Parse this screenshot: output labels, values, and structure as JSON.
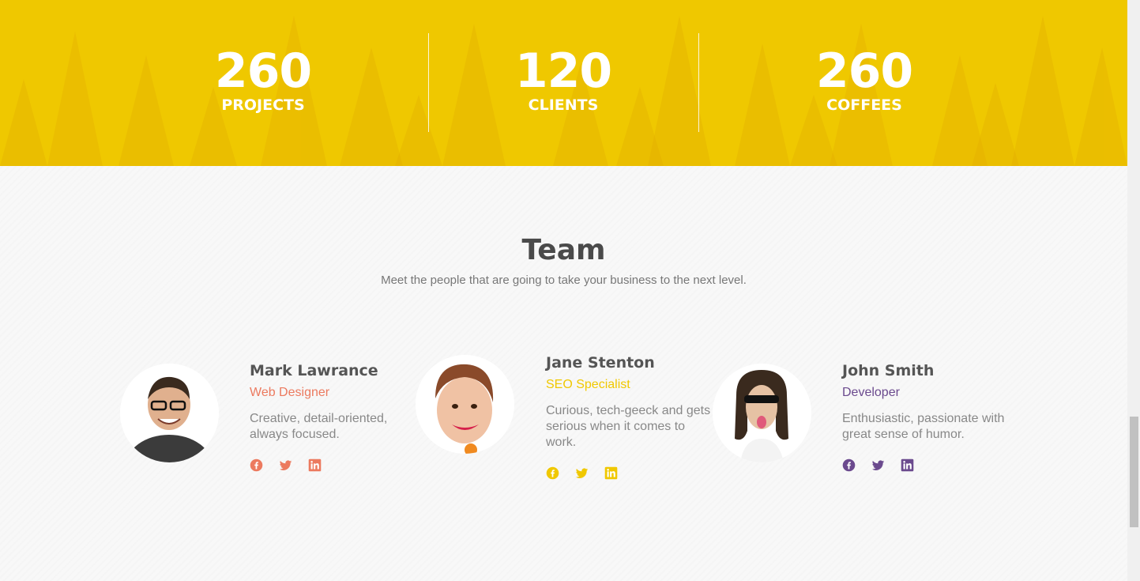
{
  "stats": [
    {
      "number": "260",
      "label": "PROJECTS"
    },
    {
      "number": "120",
      "label": "CLIENTS"
    },
    {
      "number": "260",
      "label": "COFFEES"
    }
  ],
  "team": {
    "title": "Team",
    "subtitle": "Meet the people that are going to take your business to the next level.",
    "members": [
      {
        "name": "Mark Lawrance",
        "role": "Web Designer",
        "description": "Creative, detail-oriented, always focused.",
        "accent": "#ec7a5f",
        "socials": [
          "facebook-icon",
          "twitter-icon",
          "linkedin-icon"
        ]
      },
      {
        "name": "Jane Stenton",
        "role": "SEO Specialist",
        "description": "Curious, tech-geeck and gets serious when it comes to work.",
        "accent": "#f0c800",
        "socials": [
          "facebook-icon",
          "twitter-icon",
          "linkedin-icon"
        ]
      },
      {
        "name": "John Smith",
        "role": "Developer",
        "description": "Enthusiastic, passionate with great sense of humor.",
        "accent": "#6b4a8e",
        "socials": [
          "facebook-icon",
          "twitter-icon",
          "linkedin-icon"
        ]
      }
    ]
  },
  "colors": {
    "stats_bg": "#efc800",
    "title": "#4a4a4a",
    "text": "#888888"
  }
}
